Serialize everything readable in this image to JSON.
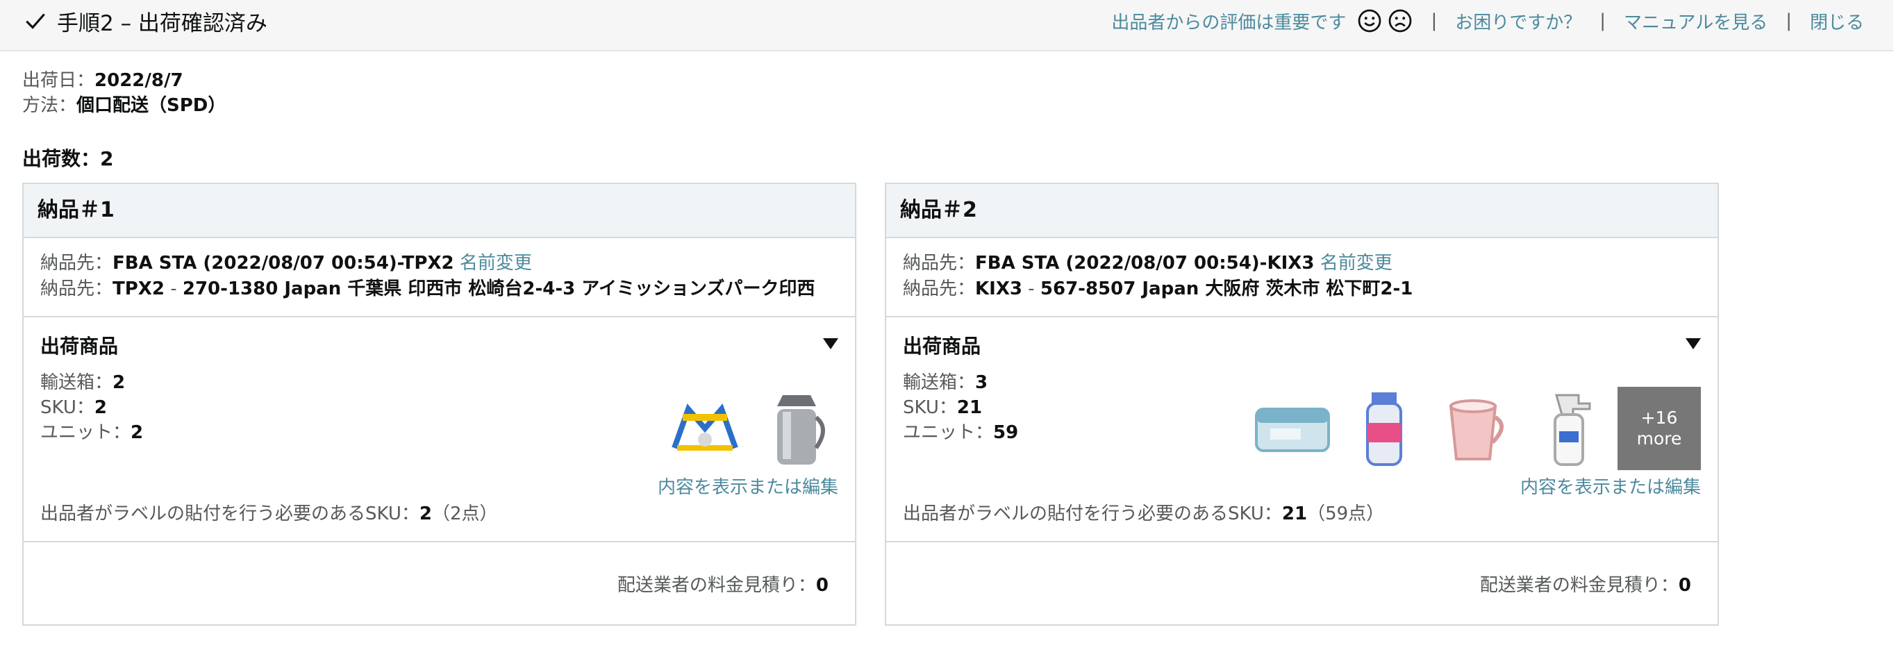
{
  "header": {
    "step_title": "手順2 – 出荷確認済み",
    "rating_text": "出品者からの評価は重要です",
    "help": "お困りですか？",
    "manual": "マニュアルを見る",
    "close": "閉じる",
    "separator": "|"
  },
  "meta": {
    "ship_date_label": "出荷日：",
    "ship_date": "2022/8/7",
    "method_label": "方法：",
    "method": "個口配送（SPD）",
    "shipment_count": "出荷数：2"
  },
  "shipments": [
    {
      "title": "納品＃1",
      "dest_label": "納品先：",
      "name": "FBA STA (2022/08/07 00:54)-TPX2",
      "rename": "名前変更",
      "fc_code": "TPX2",
      "dash": "-",
      "address": "270-1380 Japan 千葉県 印西市 松崎台2-4-3 アイミッションズパーク印西",
      "items_title": "出荷商品",
      "boxes_label": "輸送箱：",
      "boxes": "2",
      "sku_label": "SKU：",
      "sku": "2",
      "units_label": "ユニット：",
      "units": "2",
      "view_edit": "内容を表示または編集",
      "label_sku_label": "出品者がラベルの貼付を行う必要のあるSKU：",
      "label_sku_value": "2",
      "label_sku_points": "（2点）",
      "estimate_label": "配送業者の料金見積り：",
      "estimate_value": "0"
    },
    {
      "title": "納品＃2",
      "dest_label": "納品先：",
      "name": "FBA STA (2022/08/07 00:54)-KIX3",
      "rename": "名前変更",
      "fc_code": "KIX3",
      "dash": "-",
      "address": "567-8507 Japan 大阪府 茨木市 松下町2-1",
      "items_title": "出荷商品",
      "boxes_label": "輸送箱：",
      "boxes": "3",
      "sku_label": "SKU：",
      "sku": "21",
      "units_label": "ユニット：",
      "units": "59",
      "more_count": "+16",
      "more_text": "more",
      "view_edit": "内容を表示または編集",
      "label_sku_label": "出品者がラベルの貼付を行う必要のあるSKU：",
      "label_sku_value": "21",
      "label_sku_points": "（59点）",
      "estimate_label": "配送業者の料金見積り：",
      "estimate_value": "0"
    }
  ],
  "colors": {
    "link": "#4c8a9e",
    "header_bg": "#f6f6f6",
    "card_head_bg": "#f0f4f6",
    "border": "#d5d9d9"
  }
}
